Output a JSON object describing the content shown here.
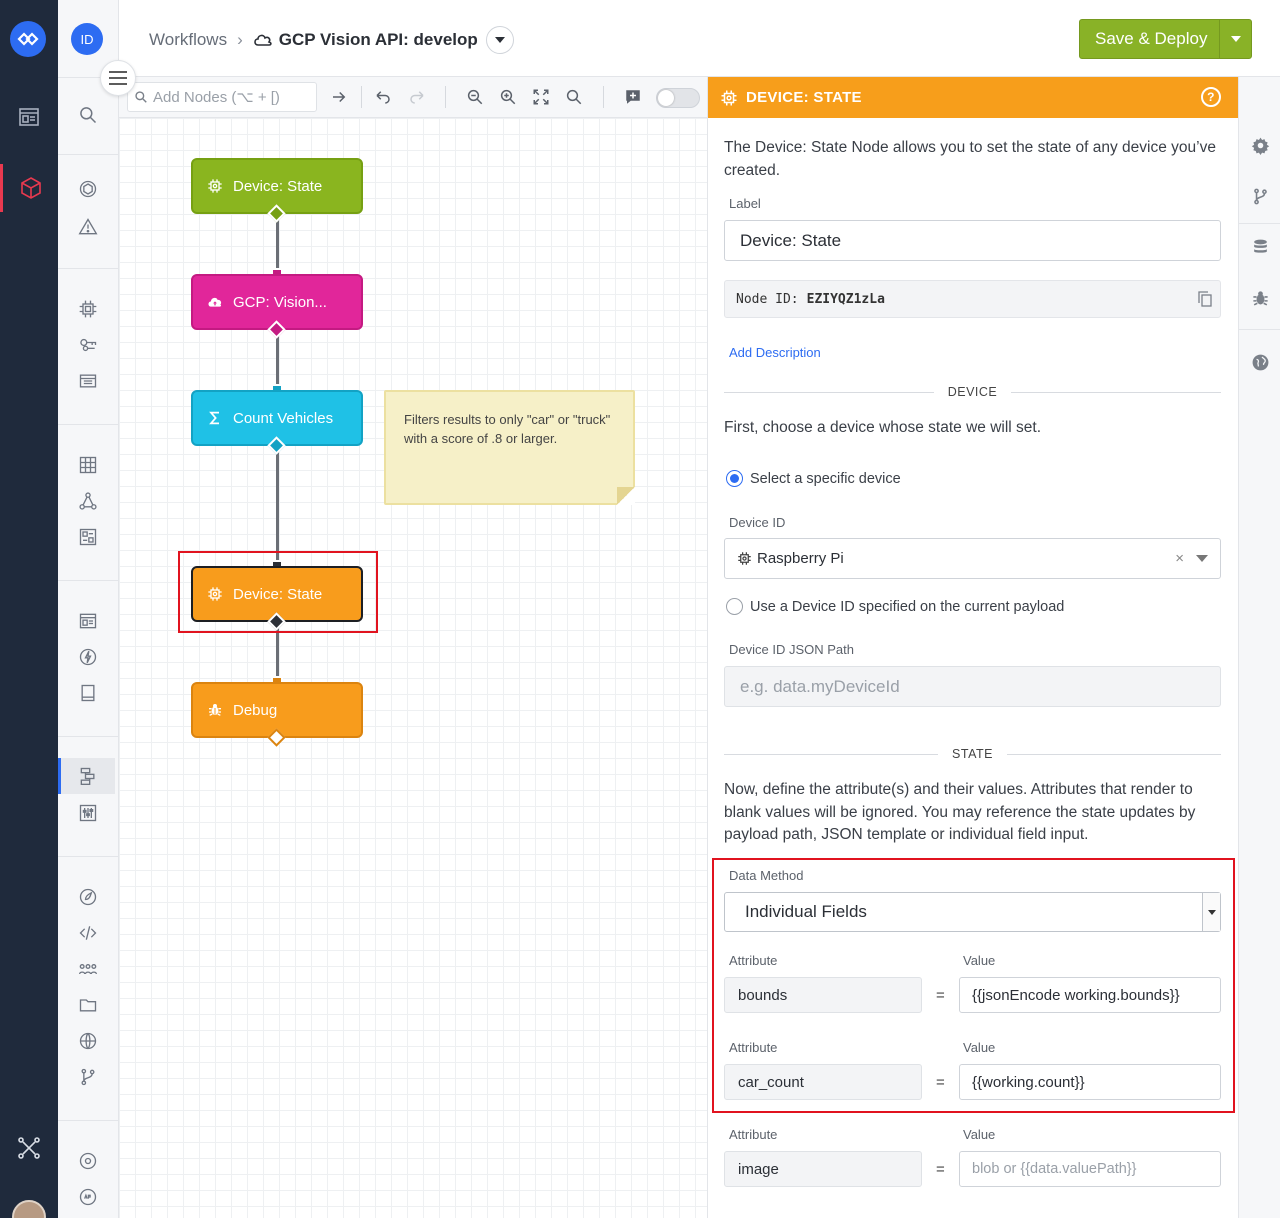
{
  "header": {
    "breadcrumb_root": "Workflows",
    "breadcrumb_sep": "›",
    "workflow_title": "GCP Vision API: develop",
    "save_deploy_label": "Save & Deploy"
  },
  "rail": {
    "user_initials": "ID"
  },
  "toolbar": {
    "add_nodes_placeholder": "Add Nodes (⌥ + [)"
  },
  "canvas": {
    "nodes": [
      {
        "label": "Device: State",
        "color": "#8ab51f",
        "icon": "chip-gear-icon"
      },
      {
        "label": "GCP: Vision...",
        "color": "#e1269a",
        "icon": "cloud-icon"
      },
      {
        "label": "Count Vehicles",
        "color": "#1fc1e6",
        "icon": "sigma-icon"
      },
      {
        "label": "Device: State",
        "color": "#f89c1c",
        "icon": "chip-gear-icon"
      },
      {
        "label": "Debug",
        "color": "#f89c1c",
        "icon": "bug-icon"
      }
    ],
    "sticky_note": "Filters results to only \"car\" or \"truck\" with a score of .8 or larger."
  },
  "panel": {
    "title": "DEVICE: STATE",
    "accent": "#f79e1b",
    "intro": "The Device: State Node allows you to set the state of any device you’ve created.",
    "label_caption": "Label",
    "label_value": "Device: State",
    "node_id_caption": "Node ID:",
    "node_id_value": "EZIYQZ1zLa",
    "add_description": "Add Description",
    "device_section": "DEVICE",
    "device_help": "First, choose a device whose state we will set.",
    "radio_specific": "Select a specific device",
    "device_id_caption": "Device ID",
    "device_id_value": "Raspberry Pi",
    "device_clear": "×",
    "radio_payload": "Use a Device ID specified on the current payload",
    "json_path_caption": "Device ID JSON Path",
    "json_path_placeholder": "e.g. data.myDeviceId",
    "state_section": "STATE",
    "state_help": "Now, define the attribute(s) and their values. Attributes that render to blank values will be ignored. You may reference the state updates by payload path, JSON template or individual field input.",
    "data_method_caption": "Data Method",
    "data_method_value": "Individual Fields",
    "attribute_caption": "Attribute",
    "value_caption": "Value",
    "equals": "=",
    "attributes": [
      {
        "name": "bounds",
        "value": "{{jsonEncode working.bounds}}",
        "placeholder": ""
      },
      {
        "name": "car_count",
        "value": "{{working.count}}",
        "placeholder": ""
      },
      {
        "name": "image",
        "value": "",
        "placeholder": "blob or {{data.valuePath}}"
      }
    ]
  }
}
